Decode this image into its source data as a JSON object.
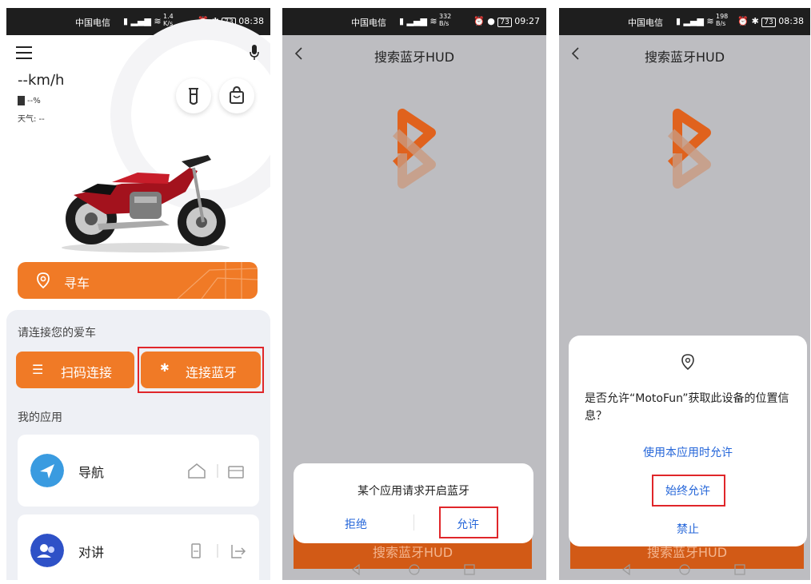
{
  "screen1": {
    "status": {
      "carrier": "中国电信",
      "net_speed": "1.4 K/s",
      "battery": "73",
      "time": "08:38"
    },
    "speed": "--km/h",
    "fuel": "--%",
    "weather": "天气: --",
    "find_car_label": "寻车",
    "connect_prompt": "请连接您的爱车",
    "scan_connect_label": "扫码连接",
    "bluetooth_connect_label": "连接蓝牙",
    "my_apps_title": "我的应用",
    "apps": [
      {
        "label": "导航"
      },
      {
        "label": "对讲"
      }
    ]
  },
  "screen2": {
    "status": {
      "carrier": "中国电信",
      "net_speed": "332 B/s",
      "battery": "73",
      "time": "09:27"
    },
    "title": "搜索蓝牙HUD",
    "dialog_message": "某个应用请求开启蓝牙",
    "deny_label": "拒绝",
    "allow_label": "允许",
    "search_button_label": "搜索蓝牙HUD"
  },
  "screen3": {
    "status": {
      "carrier": "中国电信",
      "net_speed": "198 B/s",
      "battery": "73",
      "time": "08:38"
    },
    "title": "搜索蓝牙HUD",
    "dialog_message": "是否允许“MotoFun”获取此设备的位置信息？",
    "allow_while_using_label": "使用本应用时允许",
    "always_allow_label": "始终允许",
    "deny_label": "禁止",
    "search_button_label": "搜索蓝牙HUD"
  },
  "colors": {
    "accent": "#f07a26",
    "highlight_box": "#e0262a",
    "dialog_link": "#2566d9"
  }
}
